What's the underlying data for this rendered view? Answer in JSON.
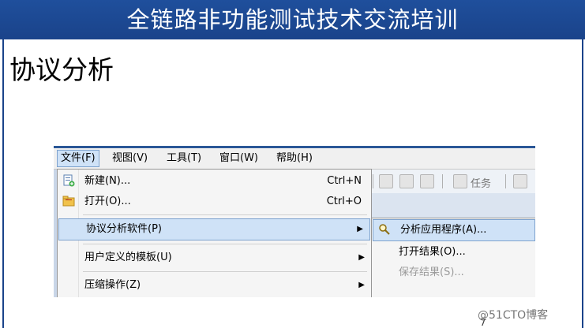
{
  "banner": {
    "title": "全链路非功能测试技术交流培训"
  },
  "slide": {
    "heading": "协议分析",
    "page_number": "7"
  },
  "watermark": "@51CTO博客",
  "menubar": {
    "items": [
      {
        "label": "文件(F)"
      },
      {
        "label": "视图(V)"
      },
      {
        "label": "工具(T)"
      },
      {
        "label": "窗口(W)"
      },
      {
        "label": "帮助(H)"
      }
    ]
  },
  "toolbar": {
    "task_label": "任务"
  },
  "file_menu": {
    "items": [
      {
        "label": "新建(N)...",
        "shortcut": "Ctrl+N",
        "icon": "new-file-icon"
      },
      {
        "label": "打开(O)...",
        "shortcut": "Ctrl+O",
        "icon": "open-folder-icon"
      },
      {
        "label": "协议分析软件(P)",
        "icon": "",
        "has_submenu": true
      },
      {
        "label": "用户定义的模板(U)",
        "has_submenu": true
      },
      {
        "label": "压缩操作(Z)",
        "has_submenu": true
      }
    ]
  },
  "submenu": {
    "items": [
      {
        "label": "分析应用程序(A)...",
        "icon": "magnifier-icon"
      },
      {
        "label": "打开结果(O)..."
      },
      {
        "label": "保存结果(S)...",
        "disabled": true
      }
    ]
  },
  "colors": {
    "banner": "#1f4f9c",
    "highlight": "#cfe2f7",
    "highlight_border": "#7da2ce"
  }
}
